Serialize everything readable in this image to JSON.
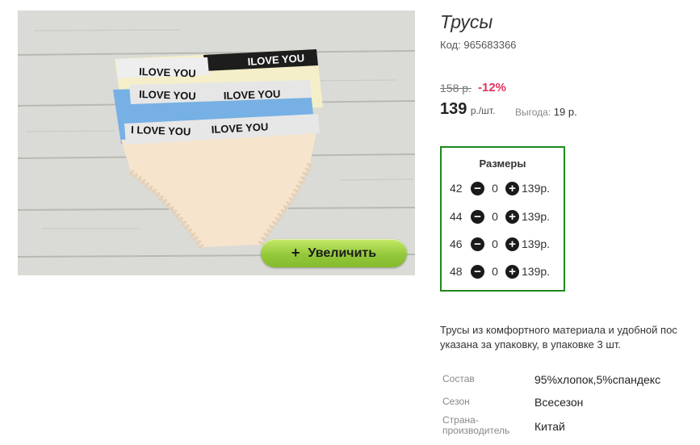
{
  "product": {
    "title": "Трусы",
    "code_label": "Код:",
    "code": "965683366"
  },
  "image": {
    "band_text": "ILOVE YOU",
    "band_text_alt": "I LOVE YOU",
    "zoom_button": {
      "icon": "+",
      "label": "Увеличить"
    }
  },
  "pricing": {
    "old_price": "158 р.",
    "discount": "-12%",
    "price": "139",
    "price_unit": "р./шт.",
    "savings_label": "Выгода:",
    "savings_value": "19 р."
  },
  "sizes": {
    "title": "Размеры",
    "rows": [
      {
        "size": "42",
        "qty": "0",
        "price": "139р."
      },
      {
        "size": "44",
        "qty": "0",
        "price": "139р."
      },
      {
        "size": "46",
        "qty": "0",
        "price": "139р."
      },
      {
        "size": "48",
        "qty": "0",
        "price": "139р."
      }
    ]
  },
  "description": {
    "line1": "Трусы из комфортного материала и удобной пос",
    "line2": "указана за упаковку, в упаковке 3 шт."
  },
  "specs": [
    {
      "label": "Состав",
      "value": "95%хлопок,5%спандекс"
    },
    {
      "label": "Сезон",
      "value": "Всесезон"
    },
    {
      "label_line1": "Страна-",
      "label_line2": "производитель",
      "value": "Китай"
    }
  ],
  "colors": {
    "accent_green": "#1d8a1d",
    "discount_red": "#e2335c",
    "zoom_button_green": "#93c83a"
  },
  "icons": {
    "minus": "minus-circle-icon",
    "plus": "plus-circle-icon"
  }
}
